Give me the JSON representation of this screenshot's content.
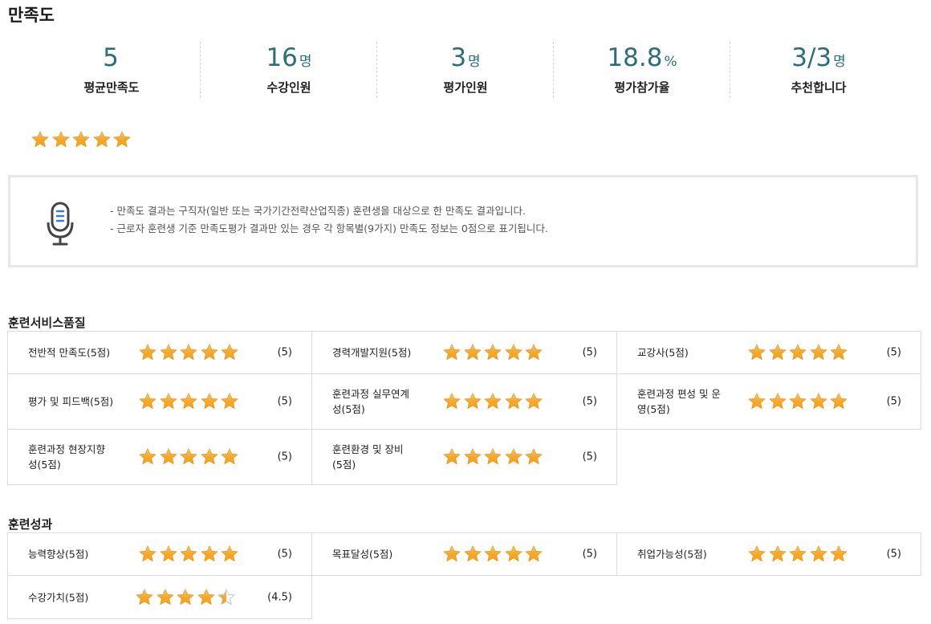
{
  "page_title": "만족도",
  "stats": [
    {
      "value": "5",
      "unit": "",
      "label": "평균만족도"
    },
    {
      "value": "16",
      "unit": "명",
      "label": "수강인원"
    },
    {
      "value": "3",
      "unit": "명",
      "label": "평가인원"
    },
    {
      "value": "18.8",
      "unit": "%",
      "label": "평가참가율"
    },
    {
      "value": "3/3",
      "unit": "명",
      "label": "추천합니다"
    }
  ],
  "overall_rating": 5,
  "notice": {
    "lines": [
      "- 만족도 결과는 구직자(일반 또는 국가기간전략산업직종) 훈련생을 대상으로 한 만족도 결과입니다.",
      "- 근로자 훈련생 기준 만족도평가 결과만 있는 경우 각 항목별(9가지) 만족도 정보는 0점으로 표기됩니다."
    ]
  },
  "colors": {
    "accent": "#2b6f79",
    "star": "#f5a623",
    "border": "#dcdcdc"
  },
  "sections": [
    {
      "title": "훈련서비스품질",
      "items": [
        {
          "label": "전반적 만족도(5점)",
          "rating": 5,
          "score": "(5)"
        },
        {
          "label": "경력개발지원(5점)",
          "rating": 5,
          "score": "(5)"
        },
        {
          "label": "교강사(5점)",
          "rating": 5,
          "score": "(5)"
        },
        {
          "label": "평가 및 피드백(5점)",
          "rating": 5,
          "score": "(5)"
        },
        {
          "label": "훈련과정 실무연계성(5점)",
          "rating": 5,
          "score": "(5)"
        },
        {
          "label": "훈련과정 편성 및 운영(5점)",
          "rating": 5,
          "score": "(5)"
        },
        {
          "label": "훈련과정 현장지향성(5점)",
          "rating": 5,
          "score": "(5)"
        },
        {
          "label": "훈련환경 및 장비(5점)",
          "rating": 5,
          "score": "(5)"
        }
      ]
    },
    {
      "title": "훈련성과",
      "items": [
        {
          "label": "능력향상(5점)",
          "rating": 5,
          "score": "(5)"
        },
        {
          "label": "목표달성(5점)",
          "rating": 5,
          "score": "(5)"
        },
        {
          "label": "취업가능성(5점)",
          "rating": 5,
          "score": "(5)"
        },
        {
          "label": "수강가치(5점)",
          "rating": 4.5,
          "score": "(4.5)"
        }
      ]
    }
  ]
}
